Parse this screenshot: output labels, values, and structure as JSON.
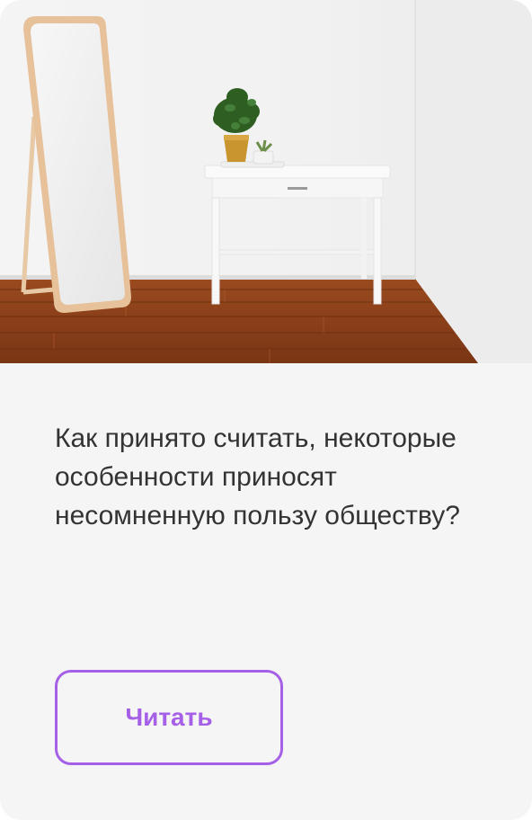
{
  "card": {
    "image_alt_icon": "room-photo",
    "title": "Как принято считать, некоторые особенности приносят несомненную пользу обществу?",
    "button_label": "Читать"
  },
  "colors": {
    "card_bg": "#f5f5f5",
    "accent": "#a660e8",
    "text": "#333333"
  }
}
